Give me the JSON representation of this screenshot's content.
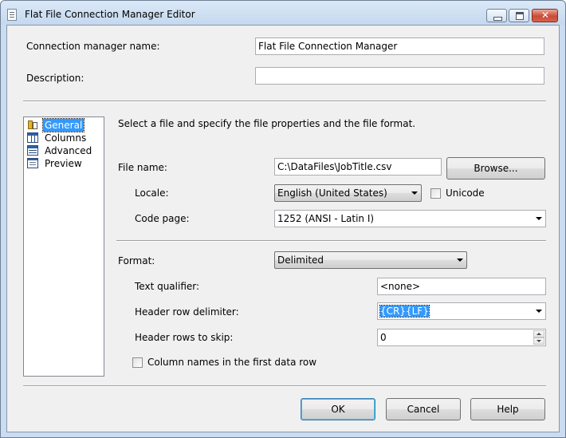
{
  "window": {
    "title": "Flat File Connection Manager Editor"
  },
  "connection": {
    "name_label": "Connection manager name:",
    "name_value": "Flat File Connection Manager",
    "description_label": "Description:",
    "description_value": ""
  },
  "nav": {
    "items": [
      {
        "label": "General",
        "icon": "general-icon",
        "selected": true
      },
      {
        "label": "Columns",
        "icon": "columns-icon",
        "selected": false
      },
      {
        "label": "Advanced",
        "icon": "advanced-icon",
        "selected": false
      },
      {
        "label": "Preview",
        "icon": "preview-icon",
        "selected": false
      }
    ]
  },
  "general": {
    "instruction": "Select a file and specify the file properties and the file format.",
    "file_name_label": "File name:",
    "file_name_value": "C:\\DataFiles\\JobTitle.csv",
    "browse_label": "Browse...",
    "locale_label": "Locale:",
    "locale_value": "English (United States)",
    "unicode_label": "Unicode",
    "unicode_checked": false,
    "code_page_label": "Code page:",
    "code_page_value": "1252  (ANSI - Latin I)",
    "format_label": "Format:",
    "format_value": "Delimited",
    "text_qualifier_label": "Text qualifier:",
    "text_qualifier_value": "<none>",
    "header_row_delimiter_label": "Header row delimiter:",
    "header_row_delimiter_value": "{CR}{LF}",
    "header_rows_skip_label": "Header rows to skip:",
    "header_rows_skip_value": "0",
    "column_names_label": "Column names in the first data row",
    "column_names_checked": false
  },
  "footer": {
    "ok_label": "OK",
    "cancel_label": "Cancel",
    "help_label": "Help"
  },
  "colors": {
    "selection": "#3399ff",
    "title_bar": "#c4d8ee",
    "close_button": "#c84b36"
  }
}
